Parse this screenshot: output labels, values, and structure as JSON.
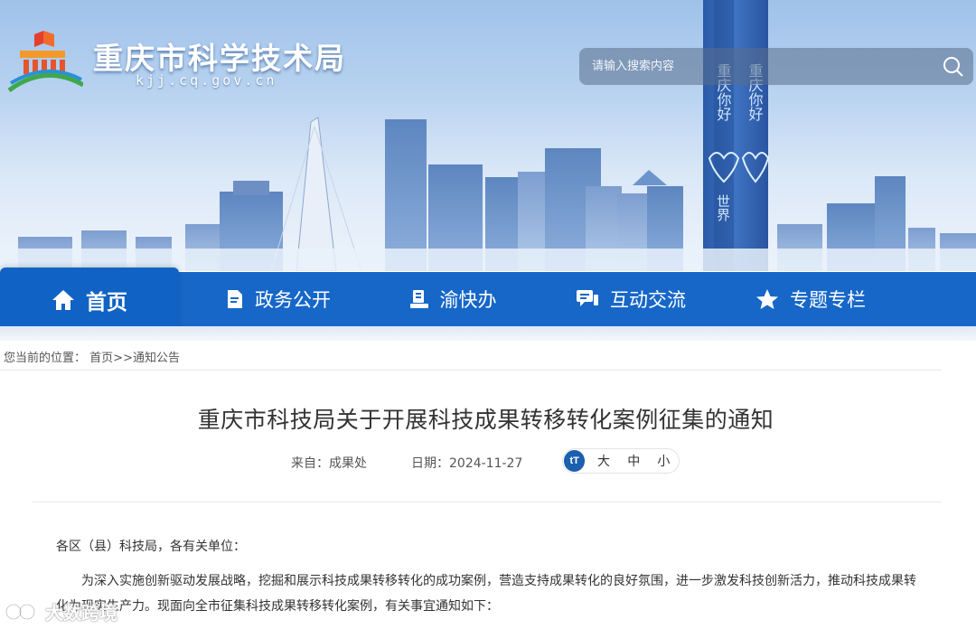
{
  "header": {
    "site_title": "重庆市科学技术局",
    "site_domain": "kjj.cq.gov.cn",
    "search_placeholder": "请输入搜索内容",
    "tower_text_left": "重庆你好",
    "tower_text_right": "重庆你好",
    "tower_text_bottom": "世界"
  },
  "nav": {
    "items": [
      {
        "label": "首页",
        "icon": "home-icon"
      },
      {
        "label": "政务公开",
        "icon": "document-icon"
      },
      {
        "label": "渝快办",
        "icon": "service-desk-icon"
      },
      {
        "label": "互动交流",
        "icon": "chat-icon"
      },
      {
        "label": "专题专栏",
        "icon": "star-icon"
      }
    ]
  },
  "breadcrumb": {
    "prefix": "您当前的位置：",
    "home": "首页",
    "sep": ">>",
    "current": "通知公告"
  },
  "article": {
    "title": "重庆市科技局关于开展科技成果转移转化案例征集的通知",
    "source": "来自：成果处",
    "date": "日期：2024-11-27",
    "fontsize_icon": "tT",
    "fontsize_options": [
      "大",
      "中",
      "小"
    ],
    "greeting": "各区（县）科技局，各有关单位：",
    "paragraph": "为深入实施创新驱动发展战略，挖掘和展示科技成果转移转化的成功案例，营造支持成果转化的良好氛围，进一步激发科技创新活力，推动科技成果转化为现实生产力。现面向全市征集科技成果转移转化案例，有关事宜通知如下："
  },
  "watermark": {
    "text": "大数跨境"
  },
  "colors": {
    "nav_blue": "#1767c8",
    "fontsize_icon_bg": "#1c5fae"
  }
}
